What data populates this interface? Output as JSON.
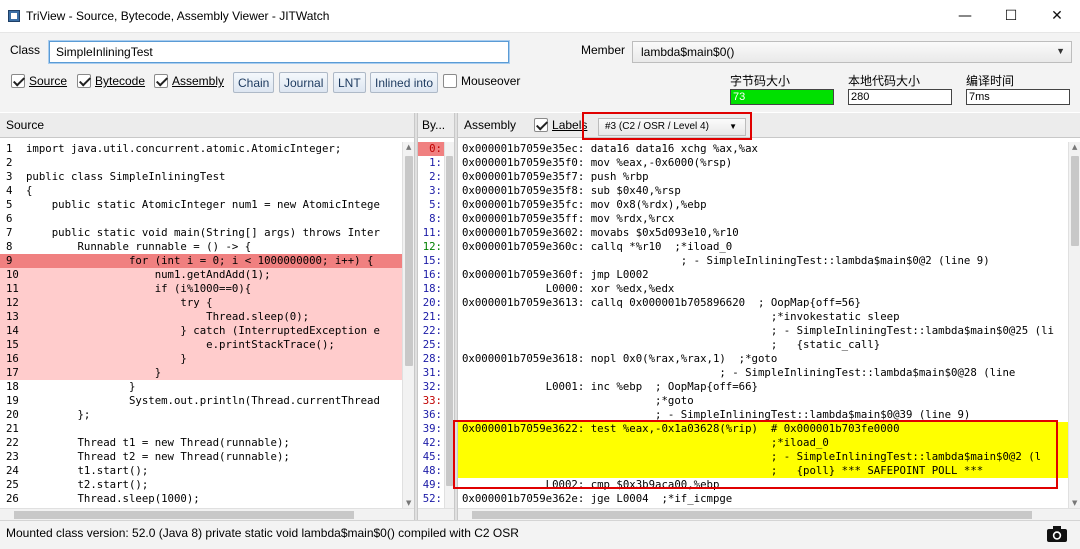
{
  "window": {
    "title": "TriView - Source, Bytecode, Assembly Viewer - JITWatch",
    "minimize": "—",
    "maximize": "☐",
    "close": "✕"
  },
  "toolbar": {
    "class_label": "Class",
    "class_value": "SimpleInliningTest",
    "member_label": "Member",
    "member_value": "lambda$main$0()",
    "checkboxes": {
      "source": {
        "label": "Source",
        "checked": true
      },
      "bytecode": {
        "label": "Bytecode",
        "checked": true
      },
      "assembly": {
        "label": "Assembly",
        "checked": true
      },
      "mouseover": {
        "label": "Mouseover",
        "checked": false
      }
    },
    "buttons": {
      "chain": "Chain",
      "journal": "Journal",
      "lnt": "LNT",
      "inlined_into": "Inlined into"
    },
    "meters": {
      "bytecode_size": {
        "label": "字节码大小",
        "value": "73"
      },
      "native_size": {
        "label": "本地代码大小",
        "value": "280"
      },
      "compile_time": {
        "label": "编译时间",
        "value": "7ms"
      }
    }
  },
  "source_pane": {
    "header": "Source",
    "lines": [
      {
        "n": "1",
        "text": "import java.util.concurrent.atomic.AtomicInteger;",
        "state": ""
      },
      {
        "n": "2",
        "text": "",
        "state": ""
      },
      {
        "n": "3",
        "text": "public class SimpleInliningTest",
        "state": ""
      },
      {
        "n": "4",
        "text": "{",
        "state": ""
      },
      {
        "n": "5",
        "text": "    public static AtomicInteger num1 = new AtomicIntege",
        "state": ""
      },
      {
        "n": "6",
        "text": "",
        "state": ""
      },
      {
        "n": "7",
        "text": "    public static void main(String[] args) throws Inter",
        "state": ""
      },
      {
        "n": "8",
        "text": "        Runnable runnable = () -> {",
        "state": ""
      },
      {
        "n": "9",
        "text": "                for (int i = 0; i < 1000000000; i++) {",
        "state": "sel"
      },
      {
        "n": "10",
        "text": "                    num1.getAndAdd(1);",
        "state": "hl"
      },
      {
        "n": "11",
        "text": "                    if (i%1000==0){",
        "state": "hl"
      },
      {
        "n": "12",
        "text": "                        try {",
        "state": "hl"
      },
      {
        "n": "13",
        "text": "                            Thread.sleep(0);",
        "state": "hl"
      },
      {
        "n": "14",
        "text": "                        } catch (InterruptedException e",
        "state": "hl"
      },
      {
        "n": "15",
        "text": "                            e.printStackTrace();",
        "state": "hl"
      },
      {
        "n": "16",
        "text": "                        }",
        "state": "hl"
      },
      {
        "n": "17",
        "text": "                    }",
        "state": "hl"
      },
      {
        "n": "18",
        "text": "                }",
        "state": ""
      },
      {
        "n": "19",
        "text": "                System.out.println(Thread.currentThread",
        "state": ""
      },
      {
        "n": "20",
        "text": "        };",
        "state": ""
      },
      {
        "n": "21",
        "text": "",
        "state": ""
      },
      {
        "n": "22",
        "text": "        Thread t1 = new Thread(runnable);",
        "state": ""
      },
      {
        "n": "23",
        "text": "        Thread t2 = new Thread(runnable);",
        "state": ""
      },
      {
        "n": "24",
        "text": "        t1.start();",
        "state": ""
      },
      {
        "n": "25",
        "text": "        t2.start();",
        "state": ""
      },
      {
        "n": "26",
        "text": "        Thread.sleep(1000);",
        "state": ""
      }
    ]
  },
  "bytecode_pane": {
    "header": "By...",
    "offsets": [
      {
        "text": "0:",
        "color": "#c00000",
        "sel": true
      },
      {
        "text": "1:",
        "color": "#1a1aa6",
        "sel": false
      },
      {
        "text": "2:",
        "color": "#1a1aa6",
        "sel": false
      },
      {
        "text": "3:",
        "color": "#1a1aa6",
        "sel": false
      },
      {
        "text": "5:",
        "color": "#1a1aa6",
        "sel": false
      },
      {
        "text": "8:",
        "color": "#1a1aa6",
        "sel": false
      },
      {
        "text": "11:",
        "color": "#1a1aa6",
        "sel": false
      },
      {
        "text": "12:",
        "color": "#008000",
        "sel": false
      },
      {
        "text": "15:",
        "color": "#1a1aa6",
        "sel": false
      },
      {
        "text": "16:",
        "color": "#1a1aa6",
        "sel": false
      },
      {
        "text": "18:",
        "color": "#1a1aa6",
        "sel": false
      },
      {
        "text": "20:",
        "color": "#1a1aa6",
        "sel": false
      },
      {
        "text": "21:",
        "color": "#1a1aa6",
        "sel": false
      },
      {
        "text": "22:",
        "color": "#1a1aa6",
        "sel": false
      },
      {
        "text": "25:",
        "color": "#1a1aa6",
        "sel": false
      },
      {
        "text": "28:",
        "color": "#1a1aa6",
        "sel": false
      },
      {
        "text": "31:",
        "color": "#1a1aa6",
        "sel": false
      },
      {
        "text": "32:",
        "color": "#1a1aa6",
        "sel": false
      },
      {
        "text": "33:",
        "color": "#c00000",
        "sel": false
      },
      {
        "text": "36:",
        "color": "#1a1aa6",
        "sel": false
      },
      {
        "text": "39:",
        "color": "#1a1aa6",
        "sel": false
      },
      {
        "text": "42:",
        "color": "#1a1aa6",
        "sel": false
      },
      {
        "text": "45:",
        "color": "#1a1aa6",
        "sel": false
      },
      {
        "text": "48:",
        "color": "#1a1aa6",
        "sel": false
      },
      {
        "text": "49:",
        "color": "#1a1aa6",
        "sel": false
      },
      {
        "text": "52:",
        "color": "#1a1aa6",
        "sel": false
      }
    ]
  },
  "assembly_pane": {
    "header": "Assembly",
    "labels_label": "Labels",
    "labels_checked": true,
    "compilation_select": "#3  (C2 / OSR / Level 4)",
    "lines": [
      {
        "text": "0x000001b7059e35ec: data16 data16 xchg %ax,%ax",
        "yel": false
      },
      {
        "text": "0x000001b7059e35f0: mov %eax,-0x6000(%rsp)",
        "yel": false
      },
      {
        "text": "0x000001b7059e35f7: push %rbp",
        "yel": false
      },
      {
        "text": "0x000001b7059e35f8: sub $0x40,%rsp",
        "yel": false
      },
      {
        "text": "0x000001b7059e35fc: mov 0x8(%rdx),%ebp",
        "yel": false
      },
      {
        "text": "0x000001b7059e35ff: mov %rdx,%rcx",
        "yel": false
      },
      {
        "text": "0x000001b7059e3602: movabs $0x5d093e10,%r10",
        "yel": false
      },
      {
        "text": "0x000001b7059e360c: callq *%r10  ;*iload_0",
        "yel": false
      },
      {
        "text": "                                  ; - SimpleInliningTest::lambda$main$0@2 (line 9)",
        "yel": false
      },
      {
        "text": "0x000001b7059e360f: jmp L0002",
        "yel": false
      },
      {
        "text": "             L0000: xor %edx,%edx",
        "yel": false
      },
      {
        "text": "0x000001b7059e3613: callq 0x000001b705896620  ; OopMap{off=56}",
        "yel": false
      },
      {
        "text": "                                                ;*invokestatic sleep",
        "yel": false
      },
      {
        "text": "                                                ; - SimpleInliningTest::lambda$main$0@25 (li",
        "yel": false
      },
      {
        "text": "                                                ;   {static_call}",
        "yel": false
      },
      {
        "text": "0x000001b7059e3618: nopl 0x0(%rax,%rax,1)  ;*goto",
        "yel": false
      },
      {
        "text": "                                        ; - SimpleInliningTest::lambda$main$0@28 (line",
        "yel": false
      },
      {
        "text": "             L0001: inc %ebp  ; OopMap{off=66}",
        "yel": false
      },
      {
        "text": "                              ;*goto",
        "yel": false
      },
      {
        "text": "                              ; - SimpleInliningTest::lambda$main$0@39 (line 9)",
        "yel": false
      },
      {
        "text": "0x000001b7059e3622: test %eax,-0x1a03628(%rip)  # 0x000001b703fe0000",
        "yel": true
      },
      {
        "text": "                                                ;*iload_0",
        "yel": true
      },
      {
        "text": "                                                ; - SimpleInliningTest::lambda$main$0@2 (l",
        "yel": true
      },
      {
        "text": "                                                ;   {poll} *** SAFEPOINT POLL ***",
        "yel": true
      },
      {
        "text": "             L0002: cmp $0x3b9aca00,%ebp",
        "yel": false
      },
      {
        "text": "0x000001b7059e362e: jge L0004  ;*if_icmpge",
        "yel": false
      }
    ]
  },
  "status_bar": {
    "text": "Mounted class version: 52.0 (Java 8) private static void lambda$main$0() compiled with C2 OSR"
  }
}
